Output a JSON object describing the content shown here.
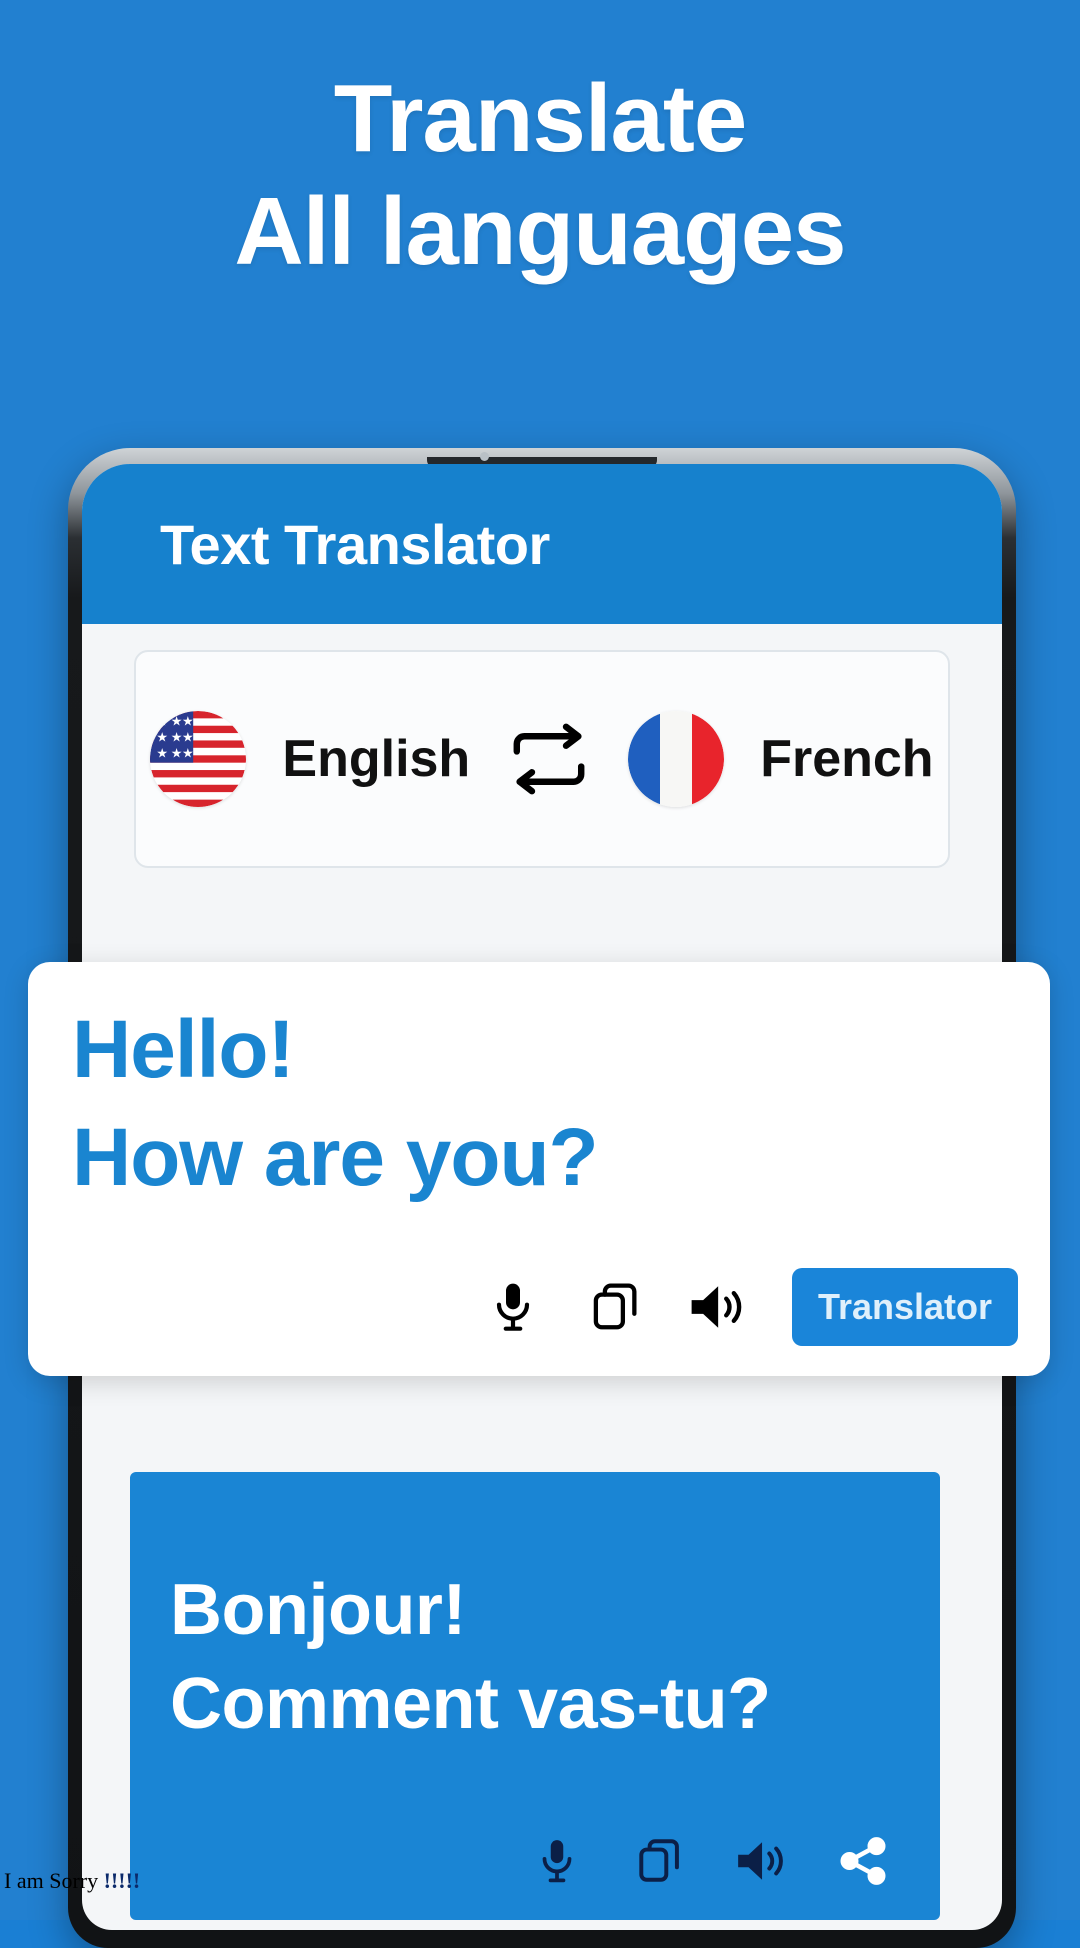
{
  "colors": {
    "background": "#2280d0",
    "appbar": "#1681cd",
    "accent": "#1a85d4",
    "source_text": "#1a85d0",
    "card_white": "#ffffff"
  },
  "promo": {
    "headline_line1": "Translate",
    "headline_line2": "All languages"
  },
  "app": {
    "title": "Text Translator",
    "language_selector": {
      "source": {
        "flag": "us-flag-icon",
        "label": "English"
      },
      "swap": {
        "icon": "swap-arrows-icon"
      },
      "target": {
        "flag": "fr-flag-icon",
        "label": "French"
      }
    },
    "source_card": {
      "line1": "Hello!",
      "line2": "How are you?",
      "actions": [
        {
          "icon": "microphone-icon",
          "name": "mic"
        },
        {
          "icon": "copy-icon",
          "name": "copy"
        },
        {
          "icon": "speaker-icon",
          "name": "speak"
        }
      ],
      "translate_button": "Translator"
    },
    "result_card": {
      "line1": "Bonjour!",
      "line2": "Comment vas-tu?",
      "actions": [
        {
          "icon": "microphone-icon",
          "name": "mic"
        },
        {
          "icon": "copy-icon",
          "name": "copy"
        },
        {
          "icon": "speaker-icon",
          "name": "speak"
        },
        {
          "icon": "share-icon",
          "name": "share"
        }
      ]
    }
  },
  "watermark": {
    "text": "I am Sorry ",
    "bangs": "!!!!!"
  }
}
